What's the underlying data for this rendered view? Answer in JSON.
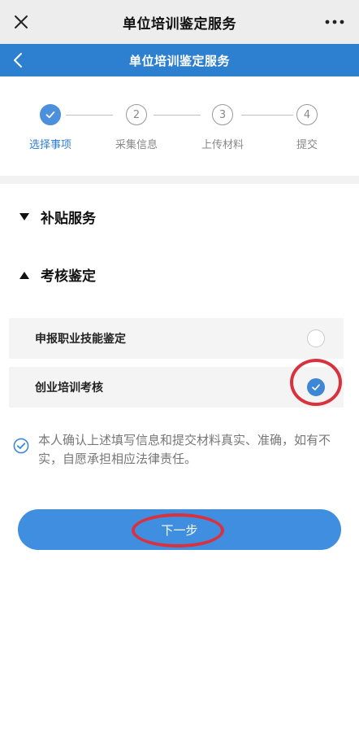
{
  "wechat_bar": {
    "title": "单位培训鉴定服务",
    "close_icon": "close-icon",
    "more_icon": "more-dots-icon"
  },
  "header": {
    "title": "单位培训鉴定服务",
    "back_icon": "chevron-left-icon"
  },
  "steps": [
    {
      "number": "",
      "label": "选择事项",
      "state": "done"
    },
    {
      "number": "2",
      "label": "采集信息",
      "state": "pending"
    },
    {
      "number": "3",
      "label": "上传材料",
      "state": "pending"
    },
    {
      "number": "4",
      "label": "提交",
      "state": "pending"
    }
  ],
  "sections": {
    "subsidy": {
      "title": "补贴服务",
      "expanded": false
    },
    "assessment": {
      "title": "考核鉴定",
      "expanded": true,
      "options": [
        {
          "label": "申报职业技能鉴定",
          "selected": false
        },
        {
          "label": "创业培训考核",
          "selected": true
        }
      ]
    }
  },
  "confirm": {
    "checked": true,
    "text": "本人确认上述填写信息和提交材料真实、准确，如有不实，自愿承担相应法律责任。"
  },
  "next_button": {
    "label": "下一步"
  },
  "colors": {
    "primary": "#2d7fcf",
    "accent": "#3f8ee0",
    "highlight_ring": "#d9323e"
  }
}
